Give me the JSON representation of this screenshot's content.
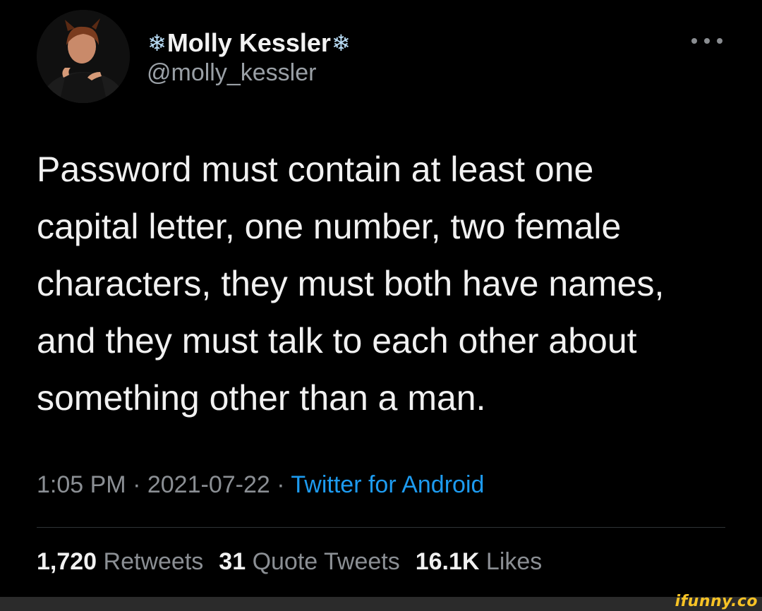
{
  "author": {
    "display_name": "Molly Kessler",
    "name_decoration": "❄",
    "handle": "@molly_kessler",
    "avatar_icon": "profile-photo",
    "more_icon": "more-horizontal-icon"
  },
  "tweet": {
    "lines": [
      "Password must contain at least one",
      "capital letter, one number, two female",
      "characters, they must both have names,",
      "and they must talk to each other about",
      "something other than a man."
    ],
    "time": "1:05 PM",
    "separator": "·",
    "date": "2021-07-22",
    "source": "Twitter for Android"
  },
  "stats": {
    "retweets_count": "1,720",
    "retweets_label": "Retweets",
    "quotes_count": "31",
    "quotes_label": "Quote Tweets",
    "likes_count": "16.1K",
    "likes_label": "Likes"
  },
  "watermark": "ifunny.co",
  "colors": {
    "background": "#000000",
    "link": "#1d9bf0",
    "secondary_text": "#8b8f94",
    "watermark": "#f7c325"
  }
}
